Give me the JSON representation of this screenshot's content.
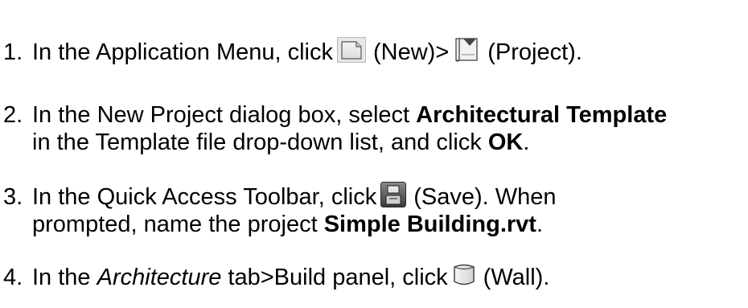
{
  "steps": [
    {
      "number": "1.",
      "text_a": "In the Application Menu, click",
      "icon_new": "new-document-icon",
      "text_b": "(New)>",
      "icon_project": "project-icon",
      "text_c": "(Project)."
    },
    {
      "number": "2.",
      "text_a": "In the New Project dialog box, select ",
      "bold_a": "Architectural Template",
      "text_b": "in the Template file drop-down list, and click ",
      "bold_b": "OK",
      "text_c": "."
    },
    {
      "number": "3.",
      "text_a": "In the Quick Access Toolbar, click",
      "icon_save": "save-icon",
      "text_b": "(Save). When",
      "text_c": "prompted, name the project ",
      "bold_a": "Simple Building.rvt",
      "text_d": "."
    },
    {
      "number": "4.",
      "text_a": "In the ",
      "italic_a": "Architecture",
      "text_b": " tab>Build panel, click",
      "icon_wall": "wall-icon",
      "text_c": "(Wall)."
    }
  ]
}
